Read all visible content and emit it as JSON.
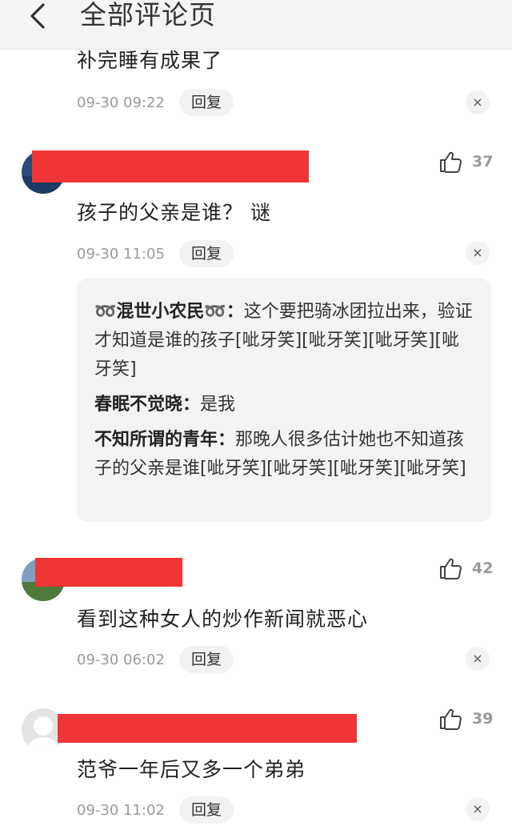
{
  "header": {
    "title": "全部评论页"
  },
  "comments": [
    {
      "text": "补完睡有成果了",
      "time": "09-30 09:22",
      "reply_label": "回复",
      "close_label": "×"
    },
    {
      "text": "孩子的父亲是谁？ 谜",
      "time": "09-30 11:05",
      "reply_label": "回复",
      "close_label": "×",
      "likes": "37",
      "replies": [
        {
          "author": "➿混世小农民➿：",
          "text": "这个要把骑冰团拉出来，验证才知道是谁的孩子[呲牙笑][呲牙笑][呲牙笑][呲牙笑]"
        },
        {
          "author": "春眠不觉晓：",
          "text": "是我"
        },
        {
          "author": "不知所谓的青年：",
          "text": "那晚人很多估计她也不知道孩子的父亲是谁[呲牙笑][呲牙笑][呲牙笑][呲牙笑]"
        }
      ]
    },
    {
      "text": "看到这种女人的炒作新闻就恶心",
      "time": "09-30 06:02",
      "reply_label": "回复",
      "close_label": "×",
      "likes": "42"
    },
    {
      "text": "范爷一年后又多一个弟弟",
      "time": "09-30 11:02",
      "reply_label": "回复",
      "close_label": "×",
      "likes": "39"
    }
  ],
  "colors": {
    "redaction": "#ef3535",
    "reply_bg": "#f3f3f3",
    "meta_text": "#9a9a9a"
  },
  "icons": {
    "back": "chevron-left-icon",
    "like": "thumbs-up-icon",
    "close": "close-icon"
  }
}
